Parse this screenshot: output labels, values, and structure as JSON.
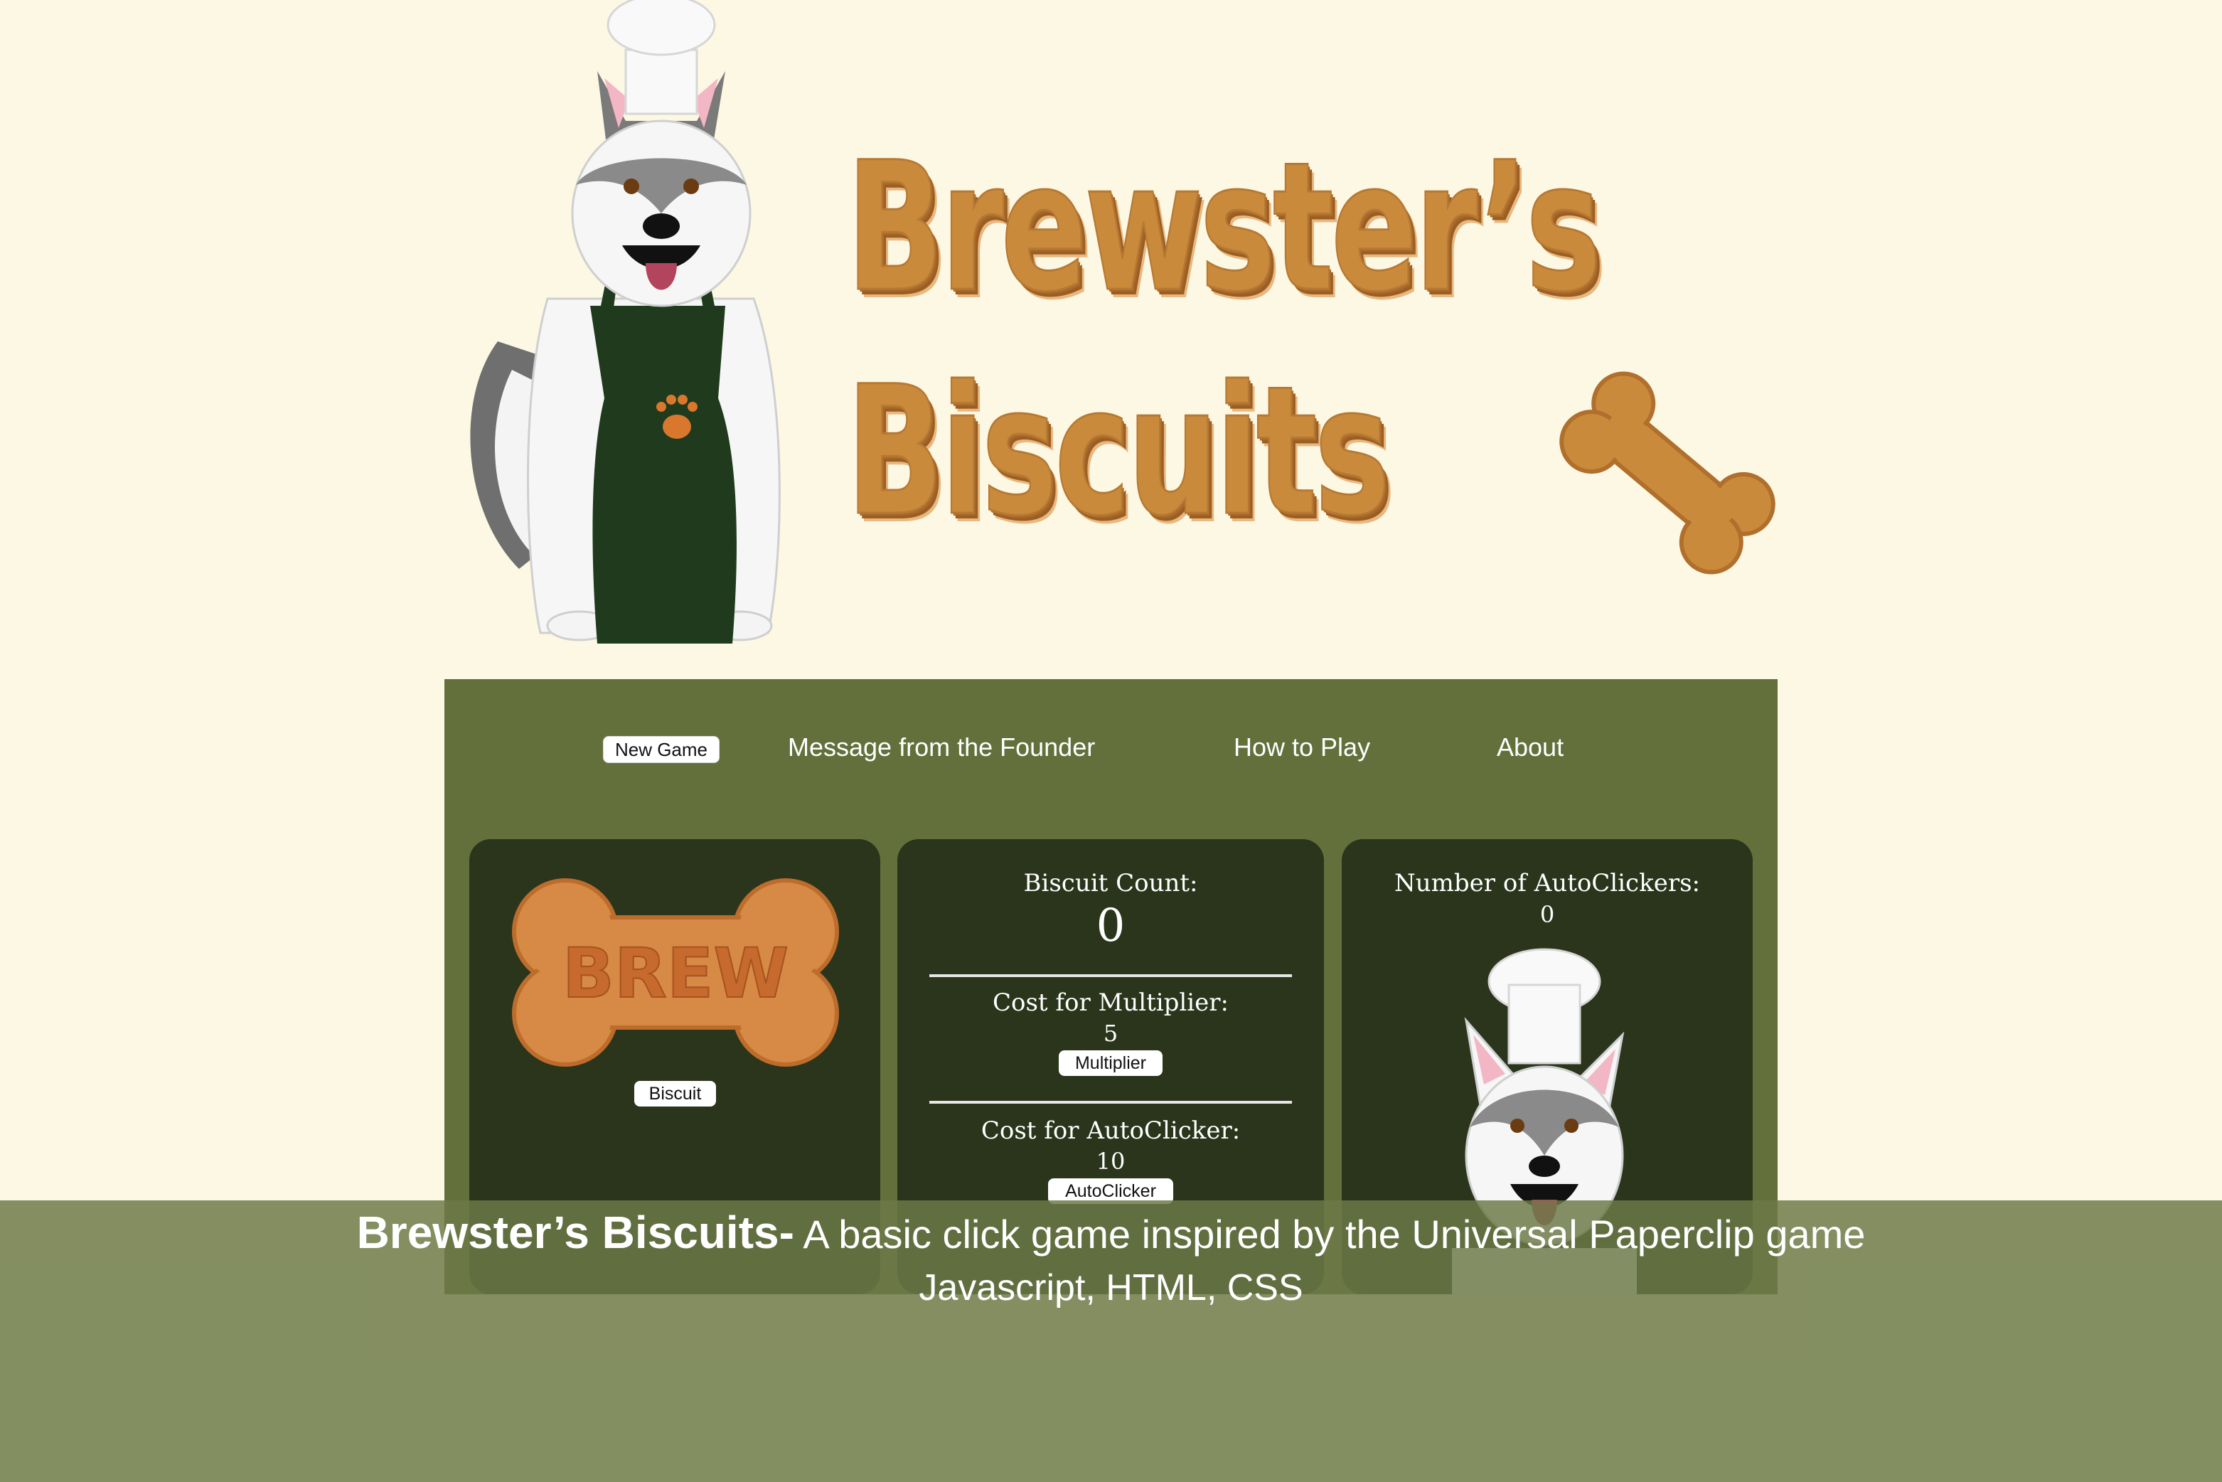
{
  "header": {
    "logo_line_1": "Brewster’s",
    "logo_line_2": "Biscuits"
  },
  "nav": {
    "new_game": "New Game",
    "founder": "Message from the Founder",
    "how_to_play": "How to Play",
    "about": "About"
  },
  "biscuit_card": {
    "bone_text": "BREW",
    "button": "Biscuit"
  },
  "stats_card": {
    "count_label": "Biscuit Count:",
    "count_value": "0",
    "multiplier_label": "Cost for Multiplier:",
    "multiplier_cost": "5",
    "multiplier_button": "Multiplier",
    "autoclicker_label": "Cost for AutoClicker:",
    "autoclicker_cost": "10",
    "autoclicker_button": "AutoClicker"
  },
  "autoclicker_card": {
    "label": "Number of AutoClickers:",
    "value": "0"
  },
  "caption": {
    "title": "Brewster’s Biscuits-",
    "description": " A basic click game inspired by the Universal Paperclip game",
    "tech": "Javascript, HTML, CSS"
  },
  "colors": {
    "background": "#fcf8e3",
    "panel": "#64703c",
    "card": "#2a351c",
    "biscuit": "#c98a3c"
  }
}
